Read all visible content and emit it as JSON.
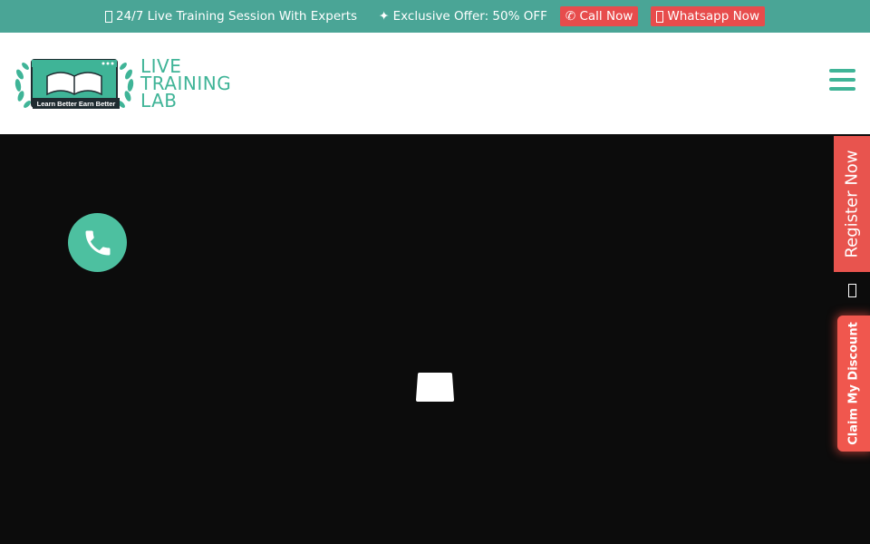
{
  "topbar": {
    "training_text": "24/7 Live Training Session With Experts",
    "offer_text": "✦ Exclusive Offer: 50% OFF",
    "call_icon": "phone-icon",
    "call_label": "✆ Call Now",
    "whatsapp_label": "Whatsapp Now",
    "bg_color": "#4aa596",
    "button_color": "#e74c4c"
  },
  "header": {
    "brand_line1": "LIVE",
    "brand_line2": "TRAINING",
    "brand_line3": "LAB",
    "tagline": "Learn Better Earn Better",
    "accent_color": "#3fb497"
  },
  "side": {
    "register_label": "Register Now",
    "claim_label": "Claim My Discount"
  },
  "icons": {
    "menu": "hamburger-menu-icon",
    "phone_fab": "phone-icon",
    "loader": "loading-placeholder-icon"
  }
}
